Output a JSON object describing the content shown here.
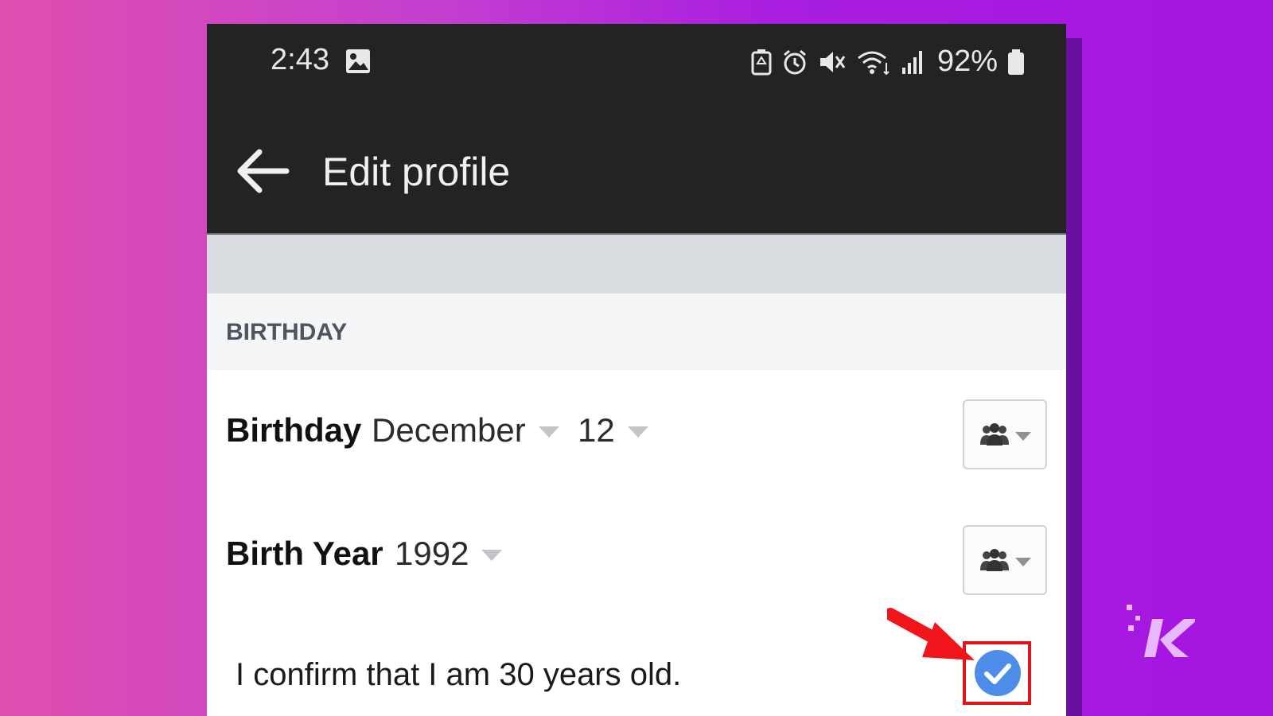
{
  "status_bar": {
    "time": "2:43",
    "battery": "92%",
    "icons": [
      "gallery-icon",
      "battery-saver-icon",
      "alarm-icon",
      "mute-icon",
      "wifi-icon",
      "signal-icon",
      "battery-icon"
    ]
  },
  "app_bar": {
    "title": "Edit profile",
    "back_icon": "arrow-left-icon"
  },
  "section": {
    "title": "BIRTHDAY"
  },
  "birthday_row": {
    "label": "Birthday",
    "month": "December",
    "day": "12",
    "audience_icon": "friends-icon"
  },
  "birth_year_row": {
    "label": "Birth Year",
    "year": "1992",
    "audience_icon": "friends-icon"
  },
  "confirm": {
    "text": "I confirm that I am 30 years old.",
    "checked": true
  },
  "colors": {
    "appbar": "#232323",
    "accent_check": "#4b8de8",
    "highlight": "#e0141a"
  }
}
